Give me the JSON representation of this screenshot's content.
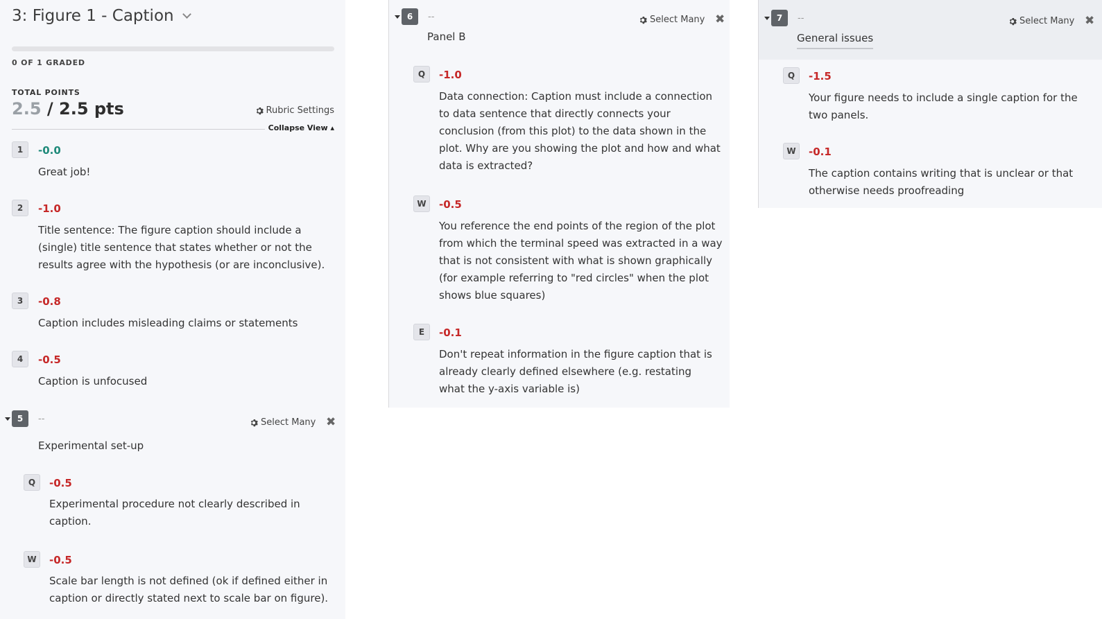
{
  "header": {
    "title": "3: Figure 1 - Caption",
    "graded": "0 OF 1 GRADED",
    "total_points_label": "TOTAL POINTS",
    "current_points": "2.5",
    "separator": " / ",
    "total_points": "2.5 pts",
    "rubric_settings": "Rubric Settings",
    "collapse_view": "Collapse View ▴",
    "progress_fraction": 0
  },
  "left_items": [
    {
      "key": "1",
      "points": "-0.0",
      "description": "Great job!"
    },
    {
      "key": "2",
      "points": "-1.0",
      "description": "Title sentence: The figure caption should include a (single) title sentence that states whether or not the results agree with the hypothesis (or are inconclusive)."
    },
    {
      "key": "3",
      "points": "-0.8",
      "description": "Caption includes misleading claims or statements"
    },
    {
      "key": "4",
      "points": "-0.5",
      "description": "Caption is unfocused"
    }
  ],
  "group5": {
    "key": "5",
    "dash": "--",
    "select_many": "Select Many",
    "name": "Experimental set-up",
    "items": [
      {
        "key": "Q",
        "points": "-0.5",
        "description": "Experimental procedure not clearly described in caption."
      },
      {
        "key": "W",
        "points": "-0.5",
        "description": "Scale bar length is not defined (ok if defined either in caption or directly stated next to scale bar on figure)."
      }
    ]
  },
  "group6": {
    "key": "6",
    "dash": "--",
    "select_many": "Select Many",
    "name": "Panel B",
    "items": [
      {
        "key": "Q",
        "points": "-1.0",
        "description": "Data connection: Caption must include a connection to data sentence that directly connects your conclusion (from this plot) to the data shown in the plot. Why are you showing the plot and how and what data is extracted?"
      },
      {
        "key": "W",
        "points": "-0.5",
        "description": "You reference the end points of the region of the plot from which the terminal speed was extracted in a way that is not consistent with what is shown graphically (for example referring to \"red circles\" when the plot shows blue squares)"
      },
      {
        "key": "E",
        "points": "-0.1",
        "description": "Don't repeat information in the figure caption that is already clearly defined elsewhere (e.g. restating what the y-axis variable is)"
      }
    ]
  },
  "group7": {
    "key": "7",
    "dash": "--",
    "select_many": "Select Many",
    "name": "General issues",
    "items": [
      {
        "key": "Q",
        "points": "-1.5",
        "description": "Your figure needs to include a single caption for the two panels."
      },
      {
        "key": "W",
        "points": "-0.1",
        "description": "The caption contains writing that is unclear or that otherwise needs proofreading"
      }
    ]
  },
  "colors": {
    "negative": "#c62828",
    "zero": "#1f8a7a",
    "panel_bg": "#f6f7fa"
  }
}
